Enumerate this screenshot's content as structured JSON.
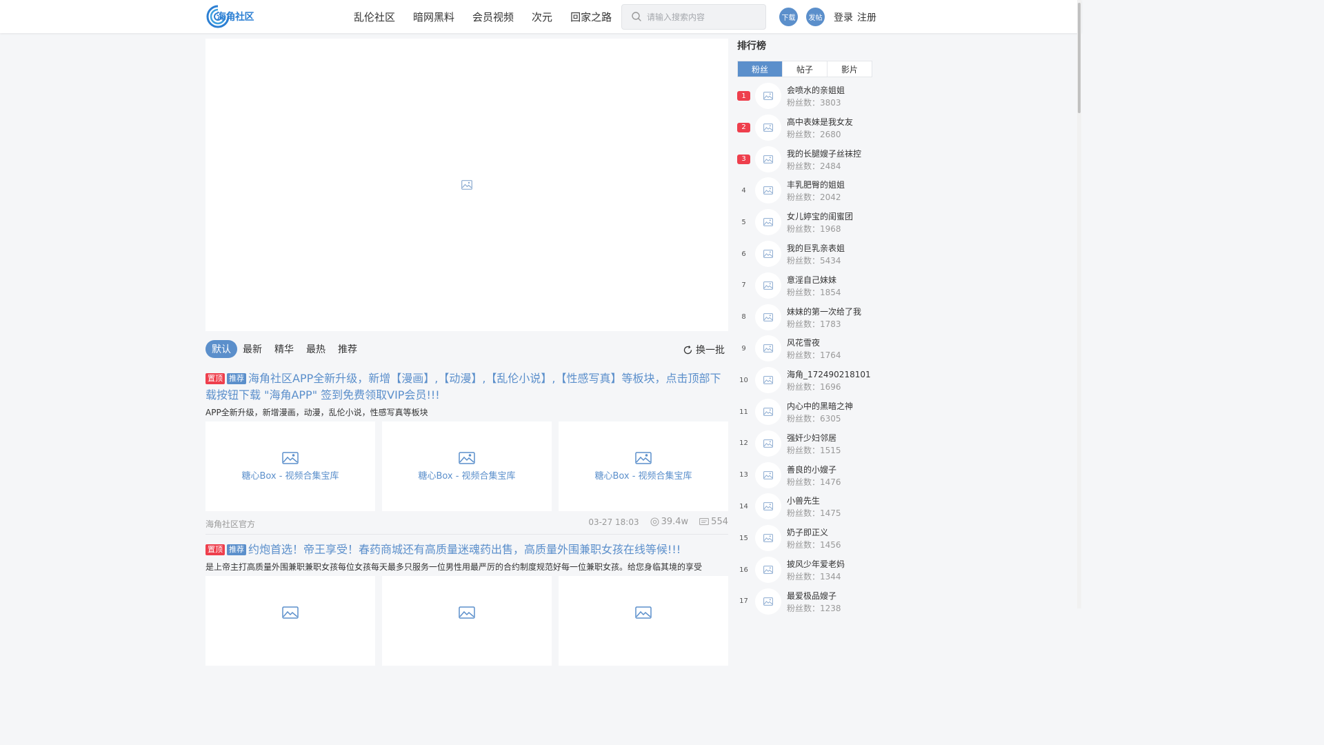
{
  "brand": {
    "logo_text": "海角社区",
    "logo_icon": "swirl-logo-icon"
  },
  "nav": [
    {
      "label": "乱伦社区"
    },
    {
      "label": "暗网黑料"
    },
    {
      "label": "会员视频"
    },
    {
      "label": "次元"
    },
    {
      "label": "回家之路"
    }
  ],
  "search": {
    "placeholder": "请输入搜索内容",
    "icon": "search-icon"
  },
  "header_buttons": {
    "download": "下载",
    "post": "发帖"
  },
  "auth": {
    "login": "登录",
    "register": "注册"
  },
  "colors": {
    "accent": "#5b8fcb",
    "hot": "#ee3f4d",
    "background": "#f5f6f8"
  },
  "feed_tabs": [
    {
      "label": "默认",
      "active": true
    },
    {
      "label": "最新"
    },
    {
      "label": "精华"
    },
    {
      "label": "最热"
    },
    {
      "label": "推荐"
    }
  ],
  "refresh_label": "换一批",
  "posts": [
    {
      "badges": [
        "置顶",
        "推荐"
      ],
      "title": "海角社区APP全新升级，新增【漫画】,【动漫】,【乱伦小说】,【性感写真】等板块，点击顶部下载按钮下载 \"海角APP\" 签到免费领取VIP会员!!!",
      "desc": "APP全新升级，新增漫画，动漫，乱伦小说，性感写真等板块",
      "thumbs": [
        "糖心Box - 视频合集宝库",
        "糖心Box - 视频合集宝库",
        "糖心Box - 视频合集宝库"
      ],
      "author": "海角社区官方",
      "date": "03-27 18:03",
      "views": "39.4w",
      "comments": "554"
    },
    {
      "badges": [
        "置顶",
        "推荐"
      ],
      "title": "约炮首选！帝王享受！春药商城还有高质量迷魂药出售，高质量外围兼职女孩在线等候!!!",
      "desc": "是上帝主打高质量外围兼职兼职女孩每位女孩每天最多只服务一位男性用最严厉的合约制度规范好每一位兼职女孩。给您身临其境的享受"
    }
  ],
  "sidebar": {
    "title": "排行榜",
    "tabs": [
      {
        "label": "粉丝",
        "active": true
      },
      {
        "label": "帖子"
      },
      {
        "label": "影片"
      }
    ],
    "fans_prefix": "粉丝数：",
    "ranking": [
      {
        "rank": "1",
        "name": "会喷水的亲姐姐",
        "fans": "粉丝数：3803"
      },
      {
        "rank": "2",
        "name": "高中表妹是我女友",
        "fans": "粉丝数：2680"
      },
      {
        "rank": "3",
        "name": "我的长腿嫂子丝袜控",
        "fans": "粉丝数：2484"
      },
      {
        "rank": "4",
        "name": "丰乳肥臀的姐姐",
        "fans": "粉丝数：2042"
      },
      {
        "rank": "5",
        "name": "女儿婷宝的闺蜜团",
        "fans": "粉丝数：1968"
      },
      {
        "rank": "6",
        "name": "我的巨乳亲表姐",
        "fans": "粉丝数：5434"
      },
      {
        "rank": "7",
        "name": "意淫自己妹妹",
        "fans": "粉丝数：1854"
      },
      {
        "rank": "8",
        "name": "妹妹的第一次给了我",
        "fans": "粉丝数：1783"
      },
      {
        "rank": "9",
        "name": "风花雪夜",
        "fans": "粉丝数：1764"
      },
      {
        "rank": "10",
        "name": "海角_172490218101",
        "fans": "粉丝数：1696"
      },
      {
        "rank": "11",
        "name": "内心中的黑暗之神",
        "fans": "粉丝数：6305"
      },
      {
        "rank": "12",
        "name": "强奸少妇邻居",
        "fans": "粉丝数：1515"
      },
      {
        "rank": "13",
        "name": "善良的小嫂子",
        "fans": "粉丝数：1476"
      },
      {
        "rank": "14",
        "name": "小兽先生",
        "fans": "粉丝数：1475"
      },
      {
        "rank": "15",
        "name": "奶子即正义",
        "fans": "粉丝数：1456"
      },
      {
        "rank": "16",
        "name": "披风少年爱老妈",
        "fans": "粉丝数：1344"
      },
      {
        "rank": "17",
        "name": "最爱极品嫂子",
        "fans": "粉丝数：1238"
      }
    ]
  }
}
